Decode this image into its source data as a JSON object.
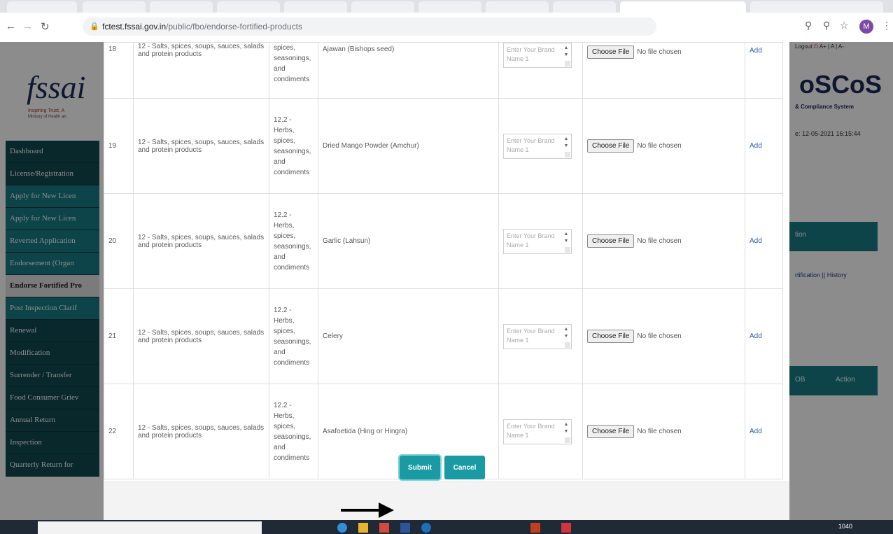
{
  "browser": {
    "url_host": "fctest.fssai.gov.in",
    "url_path": "/public/fbo/endorse-fortified-products",
    "avatar_initial": "M"
  },
  "sidebar": {
    "logo": "fssai",
    "tagline": "Inspiring Trust, A",
    "ministry": "Ministry of Health an",
    "items": [
      {
        "label": "Dashboard",
        "style": "dark"
      },
      {
        "label": "License/Registration",
        "style": "dark"
      },
      {
        "label": "Apply for New Licen",
        "style": "teal"
      },
      {
        "label": "Apply for New Licen",
        "style": "teal"
      },
      {
        "label": "Reverted Application",
        "style": "teal"
      },
      {
        "label": "Endorsement (Organ",
        "style": "teal"
      },
      {
        "label": "Endorse Fortified Pro",
        "style": "active"
      },
      {
        "label": "Post Inspection Clarif",
        "style": "teal"
      },
      {
        "label": "Renewal",
        "style": "dark"
      },
      {
        "label": "Modification",
        "style": "dark"
      },
      {
        "label": "Surrender / Transfer",
        "style": "dark"
      },
      {
        "label": "Food Consumer Griev",
        "style": "dark"
      },
      {
        "label": "Annual Return",
        "style": "dark"
      },
      {
        "label": "Inspection",
        "style": "dark"
      },
      {
        "label": "Quarterly Return for",
        "style": "dark"
      }
    ]
  },
  "rightpane": {
    "logout": "Logout",
    "font_ctrl": "A+ | A | A-",
    "logo": "oSCoS",
    "compliance": "& Compliance System",
    "date": "e: 12-05-2021 16:15:44",
    "bar1": "tion",
    "links": "rtification || History",
    "col1": "OB",
    "col2": "Action"
  },
  "modal": {
    "rows": [
      {
        "sno": "18",
        "category": "12 - Salts, spices, soups, sauces, salads and protein products",
        "sub_lines": [
          "spices,",
          "seasonings,",
          "and",
          "condiments"
        ],
        "product": "Ajawan (Bishops seed)"
      },
      {
        "sno": "19",
        "category": "12 - Salts, spices, soups, sauces, salads and protein products",
        "sub_lines": [
          "12.2 -",
          "Herbs,",
          "spices,",
          "seasonings,",
          "and",
          "condiments"
        ],
        "product": "Dried Mango Powder (Amchur)"
      },
      {
        "sno": "20",
        "category": "12 - Salts, spices, soups, sauces, salads and protein products",
        "sub_lines": [
          "12.2 -",
          "Herbs,",
          "spices,",
          "seasonings,",
          "and",
          "condiments"
        ],
        "product": "Garlic (Lahsun)"
      },
      {
        "sno": "21",
        "category": "12 - Salts, spices, soups, sauces, salads and protein products",
        "sub_lines": [
          "12.2 -",
          "Herbs,",
          "spices,",
          "seasonings,",
          "and",
          "condiments"
        ],
        "product": "Celery"
      },
      {
        "sno": "22",
        "category": "12 - Salts, spices, soups, sauces, salads and protein products",
        "sub_lines": [
          "12.2 -",
          "Herbs,",
          "spices,",
          "seasonings,",
          "and",
          "condiments"
        ],
        "product": "Asafoetida (Hing or Hingra)"
      }
    ],
    "first_row_category": "12 - Salts, spices, soups, sauces, salads and protein products",
    "brand_placeholder": "Enter Your Brand Name 1",
    "choose_file": "Choose File",
    "no_file": "No file chosen",
    "add": "Add",
    "submit": "Submit",
    "cancel": "Cancel"
  },
  "taskbar": {
    "time": "1040"
  }
}
